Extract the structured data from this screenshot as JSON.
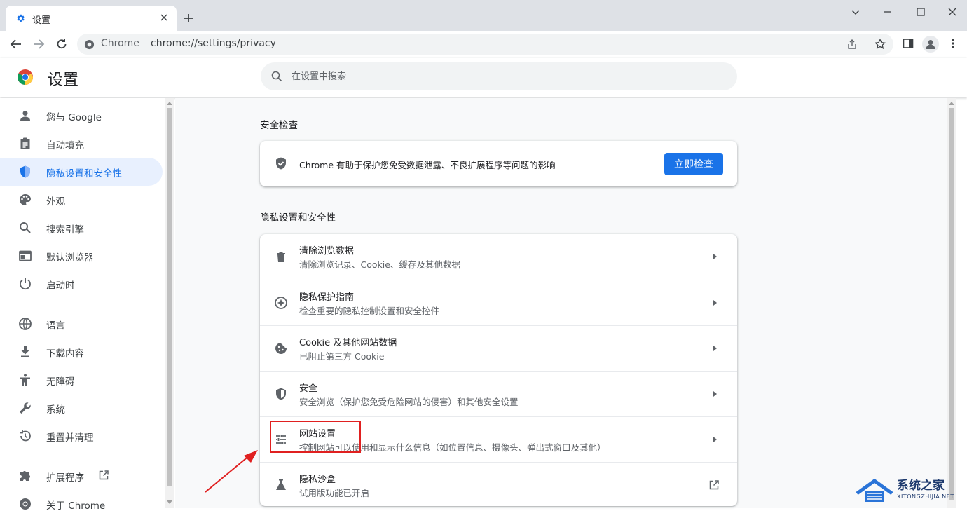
{
  "browser": {
    "tab_title": "设置",
    "omnibox": {
      "chip": "Chrome",
      "url": "chrome://settings/privacy"
    }
  },
  "settings": {
    "title": "设置",
    "search_placeholder": "在设置中搜索"
  },
  "sidebar": {
    "items": [
      {
        "label": "您与 Google",
        "icon": "person-icon"
      },
      {
        "label": "自动填充",
        "icon": "clipboard-icon"
      },
      {
        "label": "隐私设置和安全性",
        "icon": "shield-icon",
        "selected": true
      },
      {
        "label": "外观",
        "icon": "palette-icon"
      },
      {
        "label": "搜索引擎",
        "icon": "search-icon"
      },
      {
        "label": "默认浏览器",
        "icon": "browser-icon"
      },
      {
        "label": "启动时",
        "icon": "power-icon"
      },
      {
        "label": "语言",
        "icon": "globe-icon"
      },
      {
        "label": "下载内容",
        "icon": "download-icon"
      },
      {
        "label": "无障碍",
        "icon": "accessibility-icon"
      },
      {
        "label": "系统",
        "icon": "wrench-icon"
      },
      {
        "label": "重置并清理",
        "icon": "history-icon"
      },
      {
        "label": "扩展程序",
        "icon": "puzzle-icon"
      },
      {
        "label": "关于 Chrome",
        "icon": "chrome-icon"
      }
    ]
  },
  "safety_check": {
    "title": "安全检查",
    "description": "Chrome 有助于保护您免受数据泄露、不良扩展程序等问题的影响",
    "button": "立即检查"
  },
  "privacy": {
    "title": "隐私设置和安全性",
    "rows": [
      {
        "title": "清除浏览数据",
        "subtitle": "清除浏览记录、Cookie、缓存及其他数据",
        "icon": "trash-icon"
      },
      {
        "title": "隐私保护指南",
        "subtitle": "检查重要的隐私控制设置和安全控件",
        "icon": "compass-icon"
      },
      {
        "title": "Cookie 及其他网站数据",
        "subtitle": "已阻止第三方 Cookie",
        "icon": "cookie-icon"
      },
      {
        "title": "安全",
        "subtitle": "安全浏览（保护您免受危险网站的侵害）和其他安全设置",
        "icon": "shield-icon"
      },
      {
        "title": "网站设置",
        "subtitle": "控制网站可以使用和显示什么信息（如位置信息、摄像头、弹出式窗口及其他）",
        "icon": "tune-icon"
      },
      {
        "title": "隐私沙盒",
        "subtitle": "试用版功能已开启",
        "icon": "flask-icon"
      }
    ]
  },
  "watermark": {
    "name": "系统之家",
    "url": "XITONGZHIJIA.NET"
  },
  "colors": {
    "accent": "#1a73e8",
    "highlight": "#e02020"
  }
}
